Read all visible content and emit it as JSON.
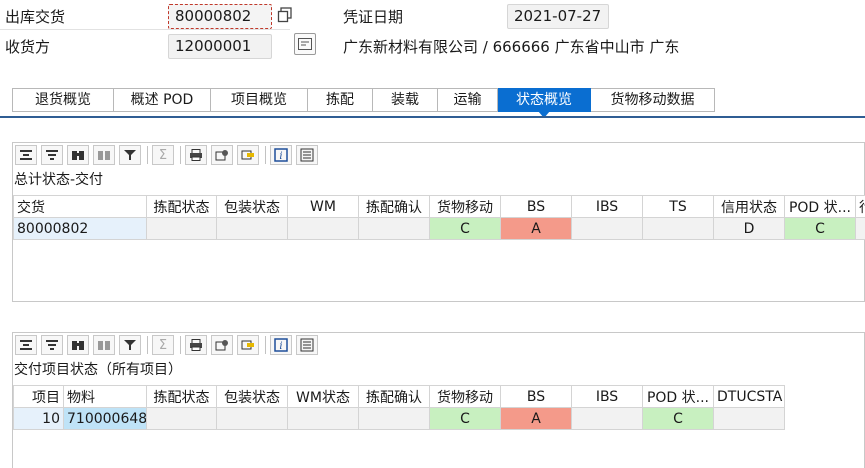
{
  "header": {
    "delivery_label": "出库交货",
    "delivery_value": "80000802",
    "date_label": "凭证日期",
    "date_value": "2021-07-27",
    "receiver_label": "收货方",
    "receiver_value": "12000001",
    "receiver_text": "广东新材料有限公司 / 666666 广东省中山市 广东"
  },
  "tabs": [
    {
      "label": "退货概览",
      "active": false
    },
    {
      "label": "概述 POD",
      "active": false
    },
    {
      "label": "项目概览",
      "active": false
    },
    {
      "label": "拣配",
      "active": false
    },
    {
      "label": "装载",
      "active": false
    },
    {
      "label": "运输",
      "active": false
    },
    {
      "label": "状态概览",
      "active": true
    },
    {
      "label": "货物移动数据",
      "active": false
    }
  ],
  "toolbar_icons": [
    "align-center-icon",
    "filter-lines-icon",
    "binoculars-icon",
    "binoculars-next-icon",
    "filter-icon",
    "sum-icon",
    "print-icon",
    "export-icon",
    "layout-icon",
    "info-icon",
    "details-icon"
  ],
  "panel1": {
    "title": "总计状态-交付",
    "columns": [
      "交货",
      "拣配状态",
      "包装状态",
      "WM",
      "拣配确认",
      "货物移动",
      "BS",
      "IBS",
      "TS",
      "信用状态",
      "POD 状...",
      "行"
    ],
    "rows": [
      [
        "80000802",
        "",
        "",
        "",
        "",
        "C",
        "A",
        "",
        "",
        "D",
        "C",
        ""
      ]
    ]
  },
  "panel2": {
    "title": "交付项目状态（所有项目）",
    "columns": [
      "项目",
      "物料",
      "拣配状态",
      "包装状态",
      "WM状态",
      "拣配确认",
      "货物移动",
      "BS",
      "IBS",
      "POD 状...",
      "DTUCSTA"
    ],
    "rows": [
      [
        "10",
        "710000648",
        "",
        "",
        "",
        "",
        "C",
        "A",
        "",
        "C",
        ""
      ]
    ]
  },
  "colors": {
    "tab_active": "#0a6ed1",
    "status_green": "#c8f0c0",
    "status_red": "#f49a8a"
  }
}
